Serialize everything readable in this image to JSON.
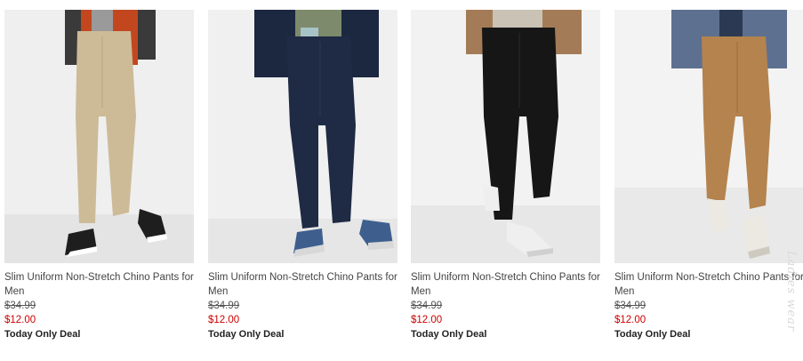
{
  "products": [
    {
      "title": "Slim Uniform Non-Stretch Chino Pants for Men",
      "original_price": "$34.99",
      "sale_price": "$12.00",
      "deal_label": "Today Only Deal",
      "pant_color": "#cdbb98",
      "top_color": "#c2471f",
      "shoe_color": "#1e1e1e"
    },
    {
      "title": "Slim Uniform Non-Stretch Chino Pants for Men",
      "original_price": "$34.99",
      "sale_price": "$12.00",
      "deal_label": "Today Only Deal",
      "pant_color": "#1f2a44",
      "top_color": "#1c2740",
      "shoe_color": "#3e5f8e"
    },
    {
      "title": "Slim Uniform Non-Stretch Chino Pants for Men",
      "original_price": "$34.99",
      "sale_price": "$12.00",
      "deal_label": "Today Only Deal",
      "pant_color": "#161616",
      "top_color": "#a37c57",
      "shoe_color": "#efefef"
    },
    {
      "title": "Slim Uniform Non-Stretch Chino Pants for Men",
      "original_price": "$34.99",
      "sale_price": "$12.00",
      "deal_label": "Today Only Deal",
      "pant_color": "#b4834e",
      "top_color": "#5d7090",
      "shoe_color": "#ece9e2"
    }
  ],
  "watermark": "Ladies wear"
}
